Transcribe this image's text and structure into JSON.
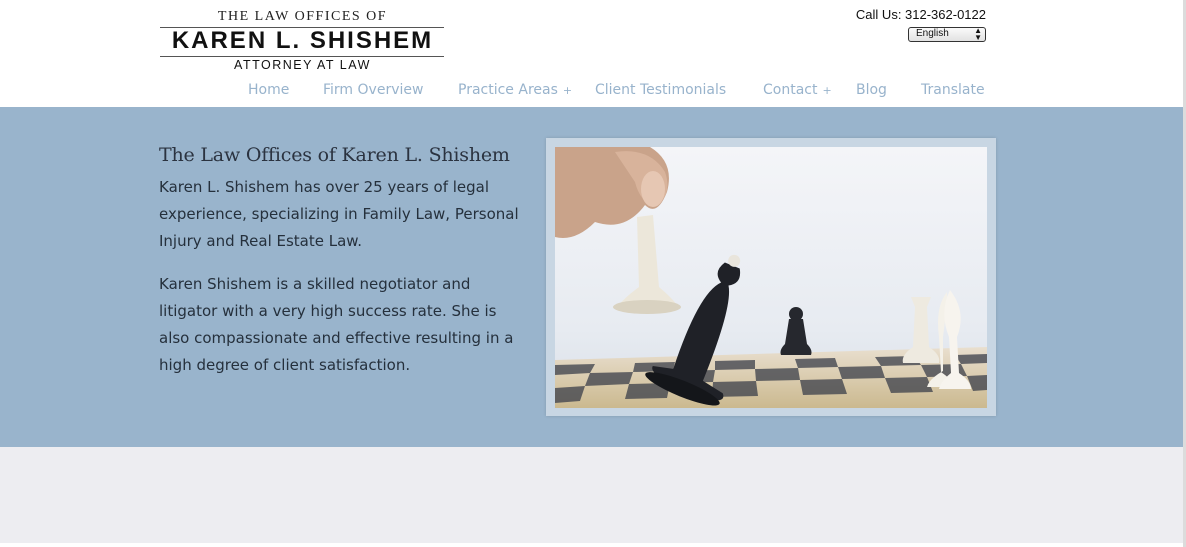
{
  "logo": {
    "line1": "The Law Offices of",
    "line2": "KAREN L. SHISHEM",
    "line3": "ATTORNEY AT LAW"
  },
  "header": {
    "call_us": "Call Us: 312-362-0122",
    "language": "English"
  },
  "nav": {
    "home": "Home",
    "firm_overview": "Firm Overview",
    "practice_areas": "Practice Areas",
    "client_testimonials": "Client Testimonials",
    "contact": "Contact",
    "blog": "Blog",
    "translate": "Translate",
    "plus": "+"
  },
  "hero": {
    "title": "The Law Offices of Karen L. Shishem",
    "paragraph1": "Karen L. Shishem has over 25 years of legal experience, specializing in Family Law, Personal Injury and Real Estate Law.",
    "paragraph2": "Karen Shishem is a skilled negotiator and litigator with a very high success rate. She is also compassionate and effective resulting in a high degree of client satisfaction.",
    "photo_icon": "chess-photo"
  },
  "colors": {
    "hero_bg": "#99b4cc",
    "nav_text": "#98b3cc",
    "lower_bg": "#ededf1"
  }
}
